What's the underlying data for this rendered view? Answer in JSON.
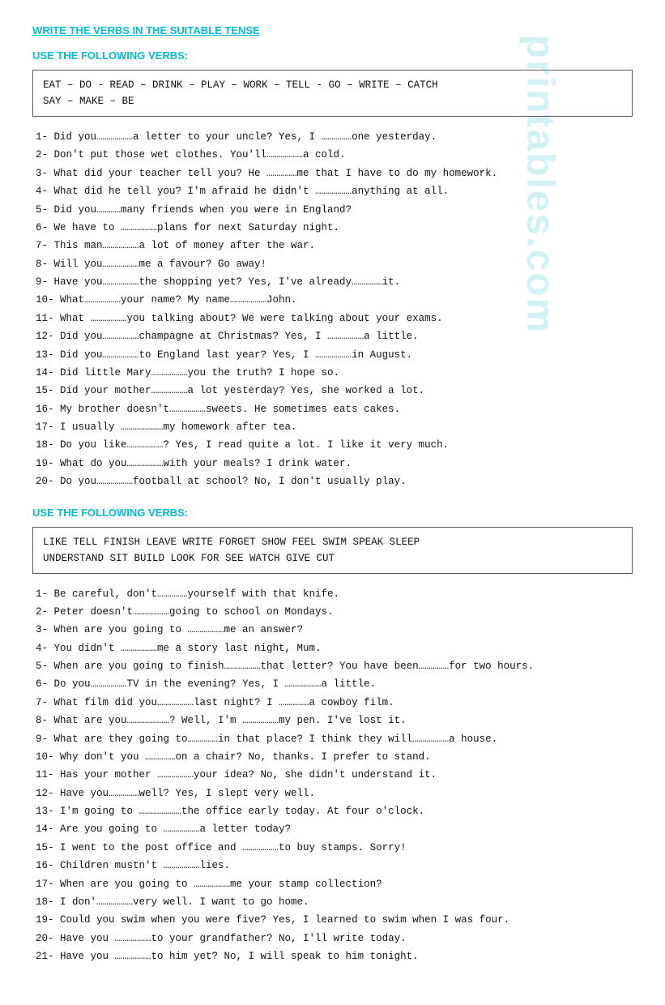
{
  "watermark": "printables.com",
  "main_title": "WRITE THE VERBS IN THE SUITABLE TENSE",
  "section1_title": "USE THE FOLLOWING VERBS:",
  "verb_box1_line1": "EAT – DO - READ – DRINK – PLAY – WORK – TELL -  GO – WRITE – CATCH",
  "verb_box1_line2": "SAY – MAKE – BE",
  "section1_items": [
    "1-  Did you………………a letter to your uncle? Yes, I ……………one yesterday.",
    "2-  Don't put those wet clothes. You'll………………a cold.",
    "3-  What did your teacher tell you? He ……………me that I have to do my homework.",
    "4-  What did he tell you? I'm afraid he didn't ………………anything at all.",
    "5-  Did you…………many friends when you were in England?",
    "6-  We have to ………………plans for next Saturday night.",
    "7-  This man………………a lot of money after the war.",
    "8-  Will you………………me a favour? Go away!",
    "9-  Have you………………the shopping yet? Yes, I've already……………it.",
    "10- What………………your name? My name………………John.",
    "11- What ………………you talking about? We were talking about your exams.",
    "12- Did you………………champagne at Christmas? Yes, I ………………a little.",
    "13- Did you………………to England last year? Yes, I ………………in August.",
    "14- Did little Mary………………you the truth? I hope so.",
    "15- Did your mother………………a lot yesterday? Yes, she worked a lot.",
    "16- My brother doesn't………………sweets. He sometimes eats cakes.",
    "17- I usually …………………my homework after tea.",
    "18- Do you like………………? Yes, I read quite a lot. I like it very much.",
    "19- What do you………………with your meals? I drink water.",
    "20- Do you………………football at school? No, I don't usually play."
  ],
  "section2_title": "USE THE FOLLOWING VERBS:",
  "verb_box2_line1": "LIKE TELL FINISH LEAVE  WRITE FORGET SHOW FEEL SWIM SPEAK SLEEP",
  "verb_box2_line2": "UNDERSTAND SIT BUILD LOOK FOR SEE WATCH GIVE CUT",
  "section2_items": [
    "1-  Be careful, don't……………yourself with that knife.",
    "2-  Peter doesn't………………going to school on Mondays.",
    "3-  When are you going to ………………me an answer?",
    "4-  You didn't ………………me a story last night, Mum.",
    "5-  When are you going to finish………………that letter? You have been……………for two hours.",
    "6-  Do you………………TV in the evening? Yes, I ………………a little.",
    "7-  What film did you………………last night? I ……………a cowboy film.",
    "8-  What are you…………………? Well, I'm ………………my pen. I've lost it.",
    "9-  What are they going to……………in that place? I think they will………………a house.",
    "10- Why don't you ……………on a chair? No, thanks. I prefer to stand.",
    "11- Has your mother ………………your idea? No, she didn't understand it.",
    "12- Have you……………well? Yes, I slept very well.",
    "13- I'm going to …………………the office early today. At four o'clock.",
    "14- Are you going to ………………a letter today?",
    "15- I went to the post office and ………………to buy stamps. Sorry!",
    "16- Children mustn't ………………lies.",
    "17- When are you going to ………………me your stamp collection?",
    "18- I don'………………very well. I want to go home.",
    "19- Could you swim when you were five? Yes, I learned to swim when I was four.",
    "20- Have you ………………to your grandfather? No, I'll write today.",
    "21- Have you ………………to him yet? No, I will speak to him tonight."
  ]
}
